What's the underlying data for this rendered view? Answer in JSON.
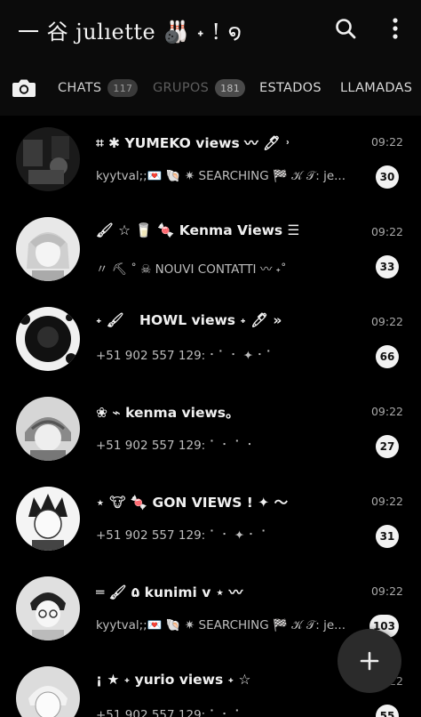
{
  "header": {
    "title": "一 谷 julıettе 🎳 ˖ ! ໑",
    "icons": {
      "search": "search-icon",
      "more": "more-vertical-icon"
    }
  },
  "tabs": {
    "camera_icon": "camera-icon",
    "items": [
      {
        "label": "CHATS",
        "badge": "117"
      },
      {
        "label": "GRUPOS",
        "badge": "181"
      },
      {
        "label": "ESTADOS"
      },
      {
        "label": "LLAMADAS"
      }
    ]
  },
  "chats": [
    {
      "name": "⌗ ✱ YUMEKO views 〰 🖊 ˒",
      "time": "09:22",
      "preview": "kyytval;;💌 🐚 ✷ SEARCHING 🏁 𝒦 𝒯: je...",
      "unread": "30"
    },
    {
      "name": "🖌 ☆ 🥛 🍬 Kenma Views ☰",
      "time": "09:22",
      "preview": "〃 ⛏ ˚ ☠ NOUVI CONTATTI 〰 ˖˚",
      "unread": "33"
    },
    {
      "name": "˖ 🖌 ⠀HOWL views ˖ 🖊 »",
      "time": "09:22",
      "preview": "+51 902 557 129: ⠂⠁ ⠂ ✦ ⠂⠁",
      "unread": "66"
    },
    {
      "name": "❀ ⌁ kenma views。",
      "time": "09:22",
      "preview": "+51 902 557 129: ⠁ ⠂ ⠁ ⠂",
      "unread": "27"
    },
    {
      "name": "⋆ 🐮 🍬 GON VIEWS ! ✦ 〜",
      "time": "09:22",
      "preview": "+51 902 557 129: ⠁ ⠂ ✦ ⠂ ⠁",
      "unread": "31"
    },
    {
      "name": "═ 🖌 ۵ kunimi v ⋆ 〰",
      "time": "09:22",
      "preview": "kyytval;;💌 🐚 ✷ SEARCHING 🏁 𝒦 𝒯: je...",
      "unread": "103"
    },
    {
      "name": "¡ ★ ˖ yurio views ˖ ☆",
      "time": "09:22",
      "preview": "+51 902 557 129: ⠁ ⠂ ⠁",
      "unread": "55"
    }
  ],
  "fab": {
    "icon": "plus-icon"
  },
  "colors": {
    "background": "#000000",
    "badge": "#f2f2f2",
    "fab": "#2b2b2b"
  }
}
